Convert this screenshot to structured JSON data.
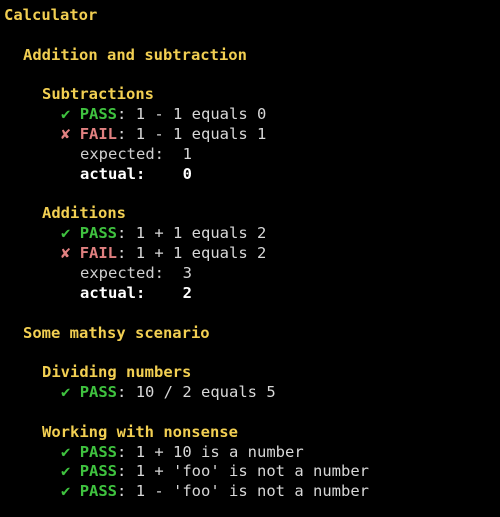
{
  "title": "Calculator",
  "suites": [
    {
      "name": "Addition and subtraction",
      "groups": [
        {
          "name": "Subtractions",
          "tests": [
            {
              "status": "PASS",
              "mark": "✔",
              "desc": "1 - 1 equals 0"
            },
            {
              "status": "FAIL",
              "mark": "✘",
              "desc": "1 - 1 equals 1",
              "expected_label": "expected:",
              "expected": "1",
              "actual_label": "actual:",
              "actual": "0"
            }
          ]
        },
        {
          "name": "Additions",
          "tests": [
            {
              "status": "PASS",
              "mark": "✔",
              "desc": "1 + 1 equals 2"
            },
            {
              "status": "FAIL",
              "mark": "✘",
              "desc": "1 + 1 equals 2",
              "expected_label": "expected:",
              "expected": "3",
              "actual_label": "actual:",
              "actual": "2"
            }
          ]
        }
      ]
    },
    {
      "name": "Some mathsy scenario",
      "groups": [
        {
          "name": "Dividing numbers",
          "tests": [
            {
              "status": "PASS",
              "mark": "✔",
              "desc": "10 / 2 equals 5"
            }
          ]
        },
        {
          "name": "Working with nonsense",
          "tests": [
            {
              "status": "PASS",
              "mark": "✔",
              "desc": "1 + 10 is a number"
            },
            {
              "status": "PASS",
              "mark": "✔",
              "desc": "1 + 'foo' is not a number"
            },
            {
              "status": "PASS",
              "mark": "✔",
              "desc": "1 - 'foo' is not a number"
            }
          ]
        }
      ]
    }
  ],
  "colors": {
    "background": "#000000",
    "heading": "#f2cf52",
    "pass": "#3fc23f",
    "fail": "#e08080",
    "text": "#d8d8d8"
  }
}
